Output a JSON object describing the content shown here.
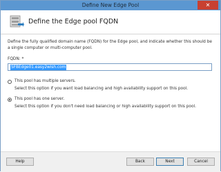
{
  "window": {
    "title": "Define New Edge Pool",
    "close_glyph": "✕"
  },
  "header": {
    "title": "Define the Edge pool FQDN",
    "icon": "wizard-pool-icon"
  },
  "body": {
    "intro_text": "Define the fully qualified domain name (FQDN) for the Edge pool, and indicate whether this should be a single computer or multi-computer pool.",
    "fqdn_label": "FQDN: *",
    "fqdn_value": "SFBEdge01.easy2wish.com",
    "options": [
      {
        "label": "This pool has multiple servers.",
        "description": "Select this option if you want load balancing and high availability support on this pool.",
        "selected": false
      },
      {
        "label": "This pool has one server.",
        "description": "Select this option if you don't need load balancing or high availability support on this pool.",
        "selected": true
      }
    ]
  },
  "footer": {
    "help_label": "Help",
    "back_label": "Back",
    "next_label": "Next",
    "cancel_label": "Cancel"
  }
}
